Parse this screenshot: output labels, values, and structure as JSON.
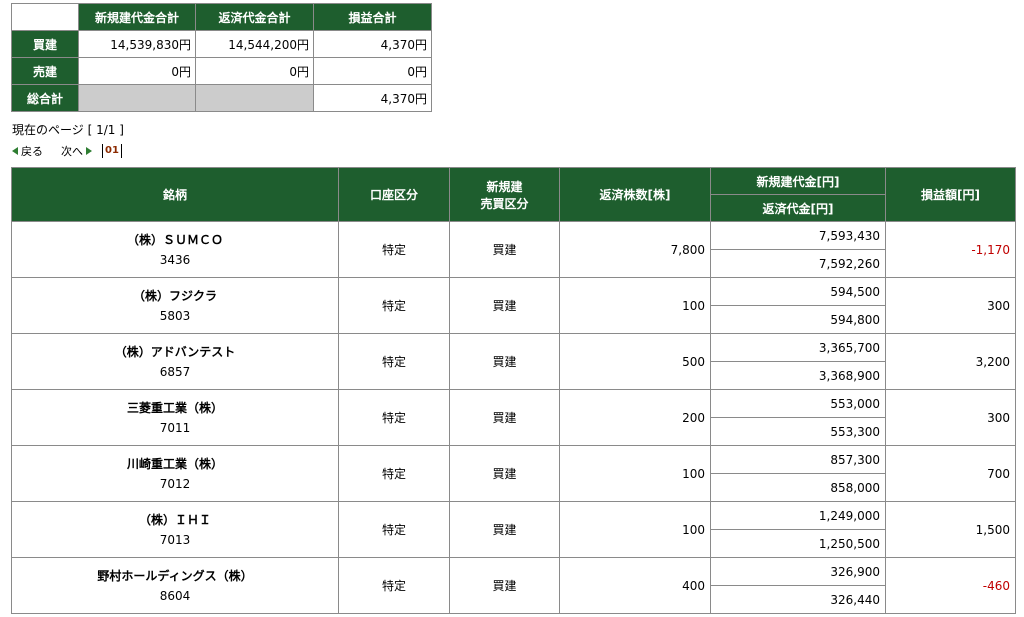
{
  "summary": {
    "headers": [
      "新規建代金合計",
      "返済代金合計",
      "損益合計"
    ],
    "rows": [
      {
        "label": "買建",
        "new_total": "14,539,830円",
        "repay_total": "14,544,200円",
        "pl_total": "4,370円"
      },
      {
        "label": "売建",
        "new_total": "0円",
        "repay_total": "0円",
        "pl_total": "0円"
      },
      {
        "label": "総合計",
        "new_total": "",
        "repay_total": "",
        "pl_total": "4,370円"
      }
    ]
  },
  "page_info": "現在のページ [ 1/1 ]",
  "pager": {
    "back": "戻る",
    "next": "次へ",
    "current": "01"
  },
  "detail": {
    "headers": {
      "name": "銘柄",
      "account": "口座区分",
      "trade_type_1": "新規建",
      "trade_type_2": "売買区分",
      "shares": "返済株数[株]",
      "new_amount": "新規建代金[円]",
      "repay_amount": "返済代金[円]",
      "pl": "損益額[円]"
    },
    "rows": [
      {
        "name": "（株）ＳＵＭＣＯ",
        "code": "3436",
        "account": "特定",
        "type": "買建",
        "shares": "7,800",
        "new_amount": "7,593,430",
        "repay_amount": "7,592,260",
        "pl": "-1,170",
        "negative": true
      },
      {
        "name": "（株）フジクラ",
        "code": "5803",
        "account": "特定",
        "type": "買建",
        "shares": "100",
        "new_amount": "594,500",
        "repay_amount": "594,800",
        "pl": "300",
        "negative": false
      },
      {
        "name": "（株）アドバンテスト",
        "code": "6857",
        "account": "特定",
        "type": "買建",
        "shares": "500",
        "new_amount": "3,365,700",
        "repay_amount": "3,368,900",
        "pl": "3,200",
        "negative": false
      },
      {
        "name": "三菱重工業（株）",
        "code": "7011",
        "account": "特定",
        "type": "買建",
        "shares": "200",
        "new_amount": "553,000",
        "repay_amount": "553,300",
        "pl": "300",
        "negative": false
      },
      {
        "name": "川崎重工業（株）",
        "code": "7012",
        "account": "特定",
        "type": "買建",
        "shares": "100",
        "new_amount": "857,300",
        "repay_amount": "858,000",
        "pl": "700",
        "negative": false
      },
      {
        "name": "（株）ＩＨＩ",
        "code": "7013",
        "account": "特定",
        "type": "買建",
        "shares": "100",
        "new_amount": "1,249,000",
        "repay_amount": "1,250,500",
        "pl": "1,500",
        "negative": false
      },
      {
        "name": "野村ホールディングス（株）",
        "code": "8604",
        "account": "特定",
        "type": "買建",
        "shares": "400",
        "new_amount": "326,900",
        "repay_amount": "326,440",
        "pl": "-460",
        "negative": true
      }
    ]
  },
  "colors": {
    "header_green": "#1e5e2e",
    "negative_red": "#c00000",
    "gray_cell": "#cccccc"
  }
}
